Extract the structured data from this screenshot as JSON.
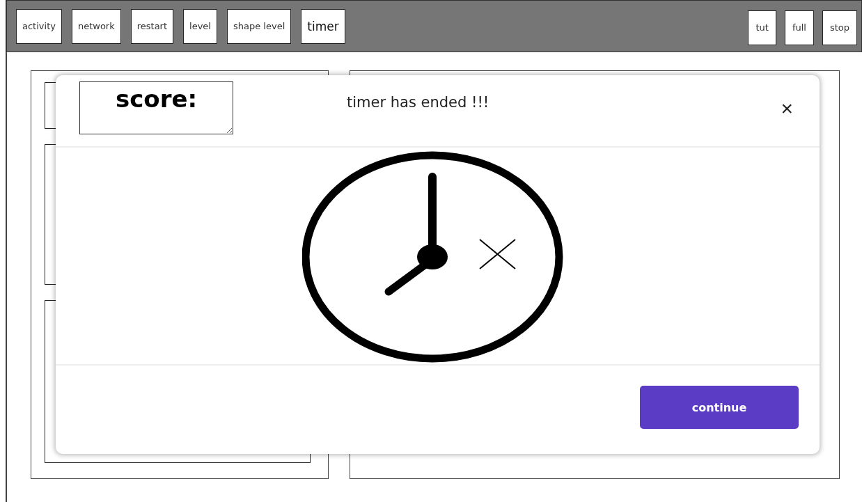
{
  "toolbar": {
    "left_buttons": [
      {
        "label": "activity",
        "kind": "small"
      },
      {
        "label": "network",
        "kind": "small"
      },
      {
        "label": "restart",
        "kind": "small"
      },
      {
        "label": "level",
        "kind": "small"
      },
      {
        "label": "shape level",
        "kind": "small"
      },
      {
        "label": "timer",
        "kind": "large"
      }
    ],
    "right_buttons": [
      {
        "label": "tut"
      },
      {
        "label": "full"
      },
      {
        "label": "stop"
      }
    ]
  },
  "dialog": {
    "score": "score:",
    "title": "timer has ended !!!",
    "close": "×",
    "button": "continue"
  }
}
